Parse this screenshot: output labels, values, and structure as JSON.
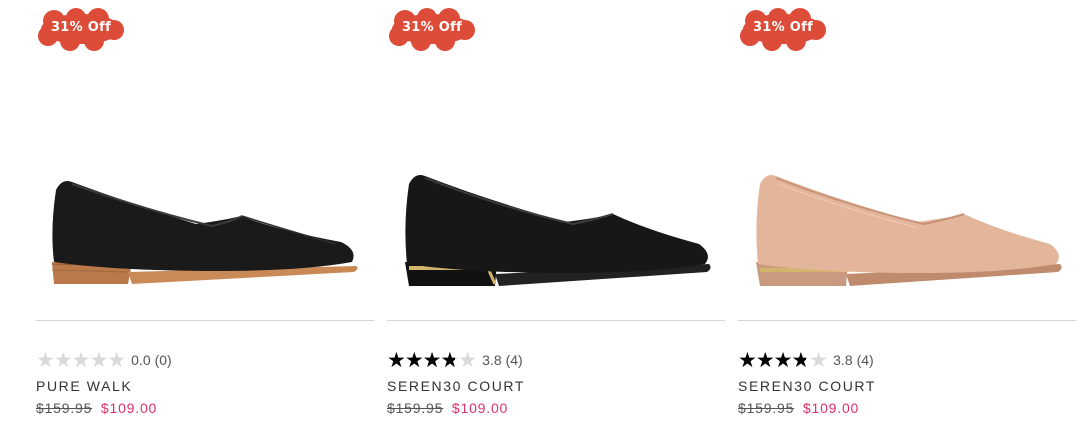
{
  "colors": {
    "badge": "#dd4b39",
    "sale_price": "#e2306c",
    "star_filled": "#000000",
    "star_empty": "#d9d9d9"
  },
  "products": [
    {
      "badge": "31% Off",
      "image": "black-leather-flat-shoe",
      "rating": 0.0,
      "rating_text": "0.0",
      "reviews": "(0)",
      "name": "PURE WALK",
      "original_price": "$159.95",
      "sale_price": "$109.00"
    },
    {
      "badge": "31% Off",
      "image": "black-leather-court-shoe-gold-heel",
      "rating": 3.8,
      "rating_text": "3.8",
      "reviews": "(4)",
      "name": "SEREN30 COURT",
      "original_price": "$159.95",
      "sale_price": "$109.00"
    },
    {
      "badge": "31% Off",
      "image": "nude-leather-court-shoe-gold-heel",
      "rating": 3.8,
      "rating_text": "3.8",
      "reviews": "(4)",
      "name": "SEREN30 COURT",
      "original_price": "$159.95",
      "sale_price": "$109.00"
    }
  ]
}
